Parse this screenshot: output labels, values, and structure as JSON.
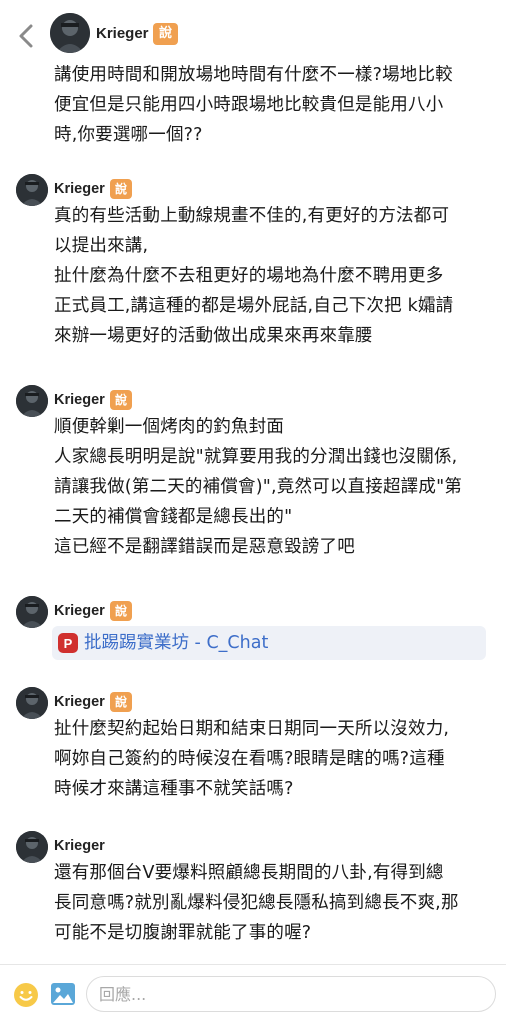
{
  "header": {
    "back_icon": "chevron-left-icon",
    "username": "Krieger",
    "badge": "說"
  },
  "messages": [
    {
      "name": "",
      "badge": "",
      "lines": [
        "講使用時間和開放場地時間有什麼不一樣?場地比較",
        "便宜但是只能用四小時跟場地比較貴但是能用八小",
        "時,你要選哪一個??"
      ]
    },
    {
      "name": "Krieger",
      "badge": "說",
      "lines": [
        "真的有些活動上動線規畫不佳的,有更好的方法都可",
        "以提出來講,",
        "扯什麼為什麼不去租更好的場地為什麼不聘用更多",
        "正式員工,講這種的都是場外屁話,自己下次把 k孀請",
        "來辦一場更好的活動做出成果來再來靠腰"
      ]
    },
    {
      "name": "Krieger",
      "badge": "說",
      "lines": [
        "順便幹剿一個烤肉的釣魚封面",
        "人家總長明明是說\"就算要用我的分潤出錢也沒關係,",
        "請讓我做(第二天的補償會)\",竟然可以直接超譯成\"第",
        "二天的補償會錢都是總長出的\"",
        "這已經不是翻譯錯誤而是惡意毀謗了吧"
      ]
    },
    {
      "name": "Krieger",
      "badge": "說",
      "link": {
        "icon": "P",
        "text": "批踢踢實業坊 - C_Chat"
      }
    },
    {
      "name": "Krieger",
      "badge": "說",
      "lines": [
        "扯什麼契約起始日期和結束日期同一天所以沒效力,",
        "啊妳自己簽約的時候沒在看嗎?眼睛是瞎的嗎?這種",
        "時候才來講這種事不就笑話嗎?"
      ]
    },
    {
      "name": "Krieger",
      "badge": "",
      "lines": [
        "還有那個台V要爆料照顧總長期間的八卦,有得到總",
        "長同意嗎?就別亂爆料侵犯總長隱私搞到總長不爽,那",
        "可能不是切腹謝罪就能了事的喔?"
      ]
    }
  ],
  "composer": {
    "emoji_icon": "emoji-icon",
    "image_icon": "image-icon",
    "placeholder": "回應..."
  },
  "colors": {
    "badge": "#f0a050",
    "link": "#3d6ec9",
    "link_bg": "#eef1f7",
    "ptt_icon": "#d0302f",
    "emoji": "#f7c948",
    "image_icon": "#5aa7d8"
  }
}
